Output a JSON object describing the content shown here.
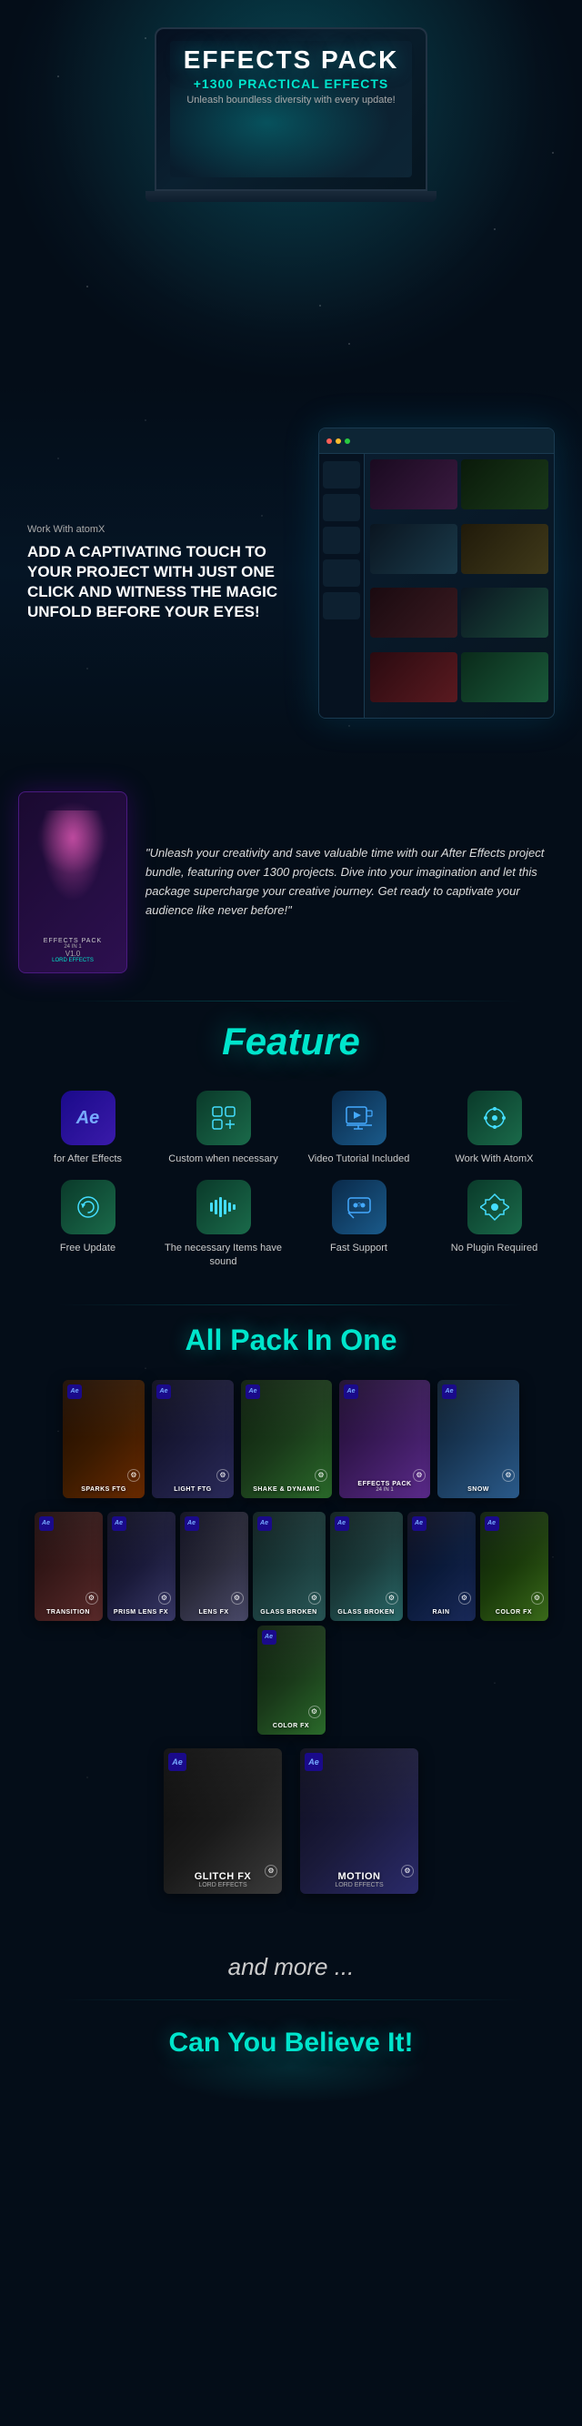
{
  "hero": {
    "title": "EFFECTS PACK",
    "subtitle": "+1300 PRACTICAL EFFECTS",
    "description": "Unleash boundless diversity with every update!"
  },
  "atomx": {
    "label": "Work With atomX",
    "title": "ADD A CAPTIVATING TOUCH TO YOUR PROJECT WITH JUST ONE CLICK AND WITNESS THE MAGIC UNFOLD BEFORE YOUR EYES!"
  },
  "quote": {
    "text": "\"Unleash your creativity and save valuable time with our After Effects project bundle, featuring over 1300 projects. Dive into your imagination and let this package supercharge your creative journey. Get ready to captivate your audience like never before!\""
  },
  "effects_box": {
    "label": "EFFECTS PACK",
    "sublabel": "24 IN 1",
    "version": "V1.0",
    "brand": "LORD EFFECTS"
  },
  "feature_section": {
    "title": "Feature",
    "items": [
      {
        "id": "ae",
        "label": "for After Effects",
        "icon_type": "ae"
      },
      {
        "id": "custom",
        "label": "Custom when necessary",
        "icon_type": "custom"
      },
      {
        "id": "video",
        "label": "Video Tutorial Included",
        "icon_type": "video"
      },
      {
        "id": "atomx",
        "label": "Work With AtomX",
        "icon_type": "atomx"
      },
      {
        "id": "update",
        "label": "Free Update",
        "icon_type": "update"
      },
      {
        "id": "sound",
        "label": "The necessary Items have sound",
        "icon_type": "sound"
      },
      {
        "id": "support",
        "label": "Fast Support",
        "icon_type": "support"
      },
      {
        "id": "plugin",
        "label": "No Plugin Required",
        "icon_type": "plugin"
      }
    ]
  },
  "pack_section": {
    "title": "All Pack In One",
    "row1": [
      {
        "id": "sparks",
        "label": "SPARKS FTG",
        "class": "pb-sparks"
      },
      {
        "id": "light",
        "label": "LIGHT FTG",
        "class": "pb-light"
      },
      {
        "id": "shake",
        "label": "SHAKE & DYNAMIC",
        "class": "pb-shake"
      },
      {
        "id": "effects",
        "label": "EFFECTS PACK",
        "sublabel": "24 IN 1",
        "class": "pb-effects"
      },
      {
        "id": "snow",
        "label": "SNOW",
        "class": "pb-snow"
      }
    ],
    "row2": [
      {
        "id": "transition",
        "label": "TRANSITION",
        "class": "pb-transition"
      },
      {
        "id": "prism",
        "label": "PRISM LENS FX",
        "class": "pb-prism"
      },
      {
        "id": "lens",
        "label": "LENS FX",
        "class": "pb-lens"
      },
      {
        "id": "glassbig",
        "label": "GLASS BROKEN",
        "class": "pb-glassbig"
      },
      {
        "id": "glass",
        "label": "GLASS BROKEN",
        "class": "pb-glass"
      },
      {
        "id": "rain",
        "label": "RAIN",
        "class": "pb-rain"
      },
      {
        "id": "colorfx",
        "label": "COLOR FX",
        "class": "pb-colorfx"
      },
      {
        "id": "color",
        "label": "COLOR FX",
        "class": "pb-color"
      }
    ],
    "row3": [
      {
        "id": "glitch",
        "label": "GLITCH FX",
        "class": "pb-glitch"
      },
      {
        "id": "motion",
        "label": "MOTION",
        "class": "pb-motion"
      }
    ]
  },
  "more": {
    "text": "and more ..."
  },
  "believe": {
    "title": "Can You Believe It!"
  }
}
